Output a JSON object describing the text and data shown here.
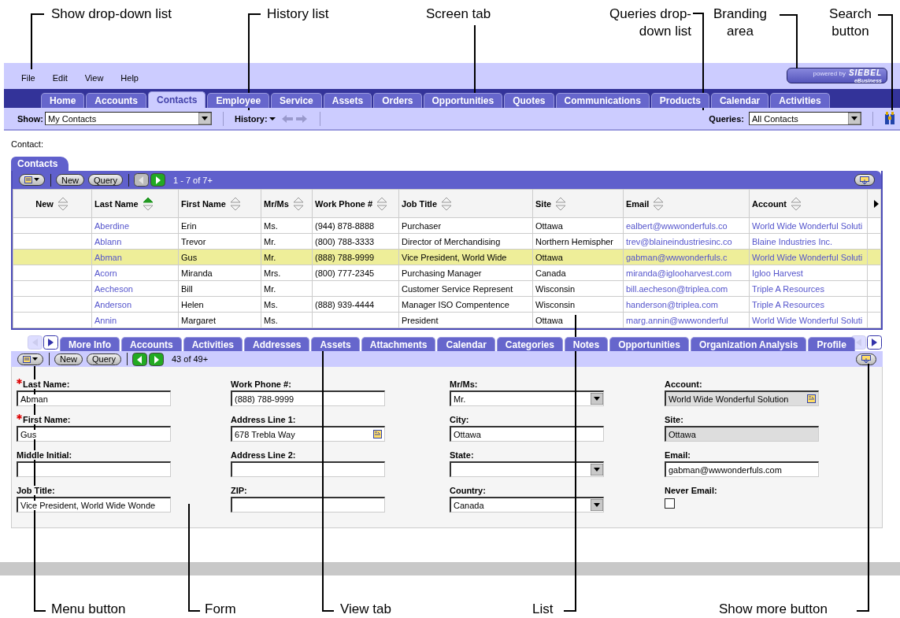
{
  "top_callouts": [
    {
      "lines": [
        "Show drop-down list"
      ]
    },
    {
      "lines": [
        "History list"
      ]
    },
    {
      "lines": [
        "Screen tab"
      ]
    },
    {
      "lines": [
        "Queries drop-",
        "down list"
      ]
    },
    {
      "lines": [
        "Branding",
        "area"
      ]
    },
    {
      "lines": [
        "Search",
        "button"
      ]
    }
  ],
  "menu_bar": [
    "File",
    "Edit",
    "View",
    "Help"
  ],
  "branding": {
    "prefix": "powered by",
    "brand": "SIEBEL",
    "suffix": "eBusiness"
  },
  "screen_tabs": [
    {
      "label": "Home",
      "selected": false
    },
    {
      "label": "Accounts",
      "selected": false
    },
    {
      "label": "Contacts",
      "selected": true
    },
    {
      "label": "Employee",
      "selected": false
    },
    {
      "label": "Service",
      "selected": false
    },
    {
      "label": "Assets",
      "selected": false
    },
    {
      "label": "Orders",
      "selected": false
    },
    {
      "label": "Opportunities",
      "selected": false
    },
    {
      "label": "Quotes",
      "selected": false
    },
    {
      "label": "Communications",
      "selected": false
    },
    {
      "label": "Products",
      "selected": false
    },
    {
      "label": "Calendar",
      "selected": false
    },
    {
      "label": "Activities",
      "selected": false
    }
  ],
  "show": {
    "label": "Show:",
    "value": "My Contacts"
  },
  "history": {
    "label": "History:"
  },
  "queries": {
    "label": "Queries:",
    "value": "All Contacts"
  },
  "context_label": "Contact:",
  "list_applet": {
    "title": "Contacts",
    "buttons": [
      "New",
      "Query"
    ],
    "nav": [
      {
        "kind": "prev",
        "disabled": true
      },
      {
        "kind": "next",
        "disabled": false
      }
    ],
    "record_count": "1 - 7 of 7+",
    "columns": [
      {
        "label": "New",
        "sorted": false
      },
      {
        "label": "Last Name",
        "sorted": true
      },
      {
        "label": "First Name",
        "sorted": false
      },
      {
        "label": "Mr/Ms",
        "sorted": false
      },
      {
        "label": "Work Phone #",
        "sorted": false
      },
      {
        "label": "Job Title",
        "sorted": false
      },
      {
        "label": "Site",
        "sorted": false
      },
      {
        "label": "Email",
        "sorted": false
      },
      {
        "label": "Account",
        "sorted": false
      }
    ],
    "rows": [
      {
        "selected": false,
        "cells": [
          "",
          "Aberdine",
          "Erin",
          "Ms.",
          "(944) 878-8888",
          "Purchaser",
          "Ottawa",
          "ealbert@wwwonderfuls.co",
          "World Wide Wonderful Soluti"
        ]
      },
      {
        "selected": false,
        "cells": [
          "",
          "Ablann",
          "Trevor",
          "Mr.",
          "(800) 788-3333",
          "Director of Merchandising",
          "Northern Hemispher",
          "trev@blaineindustriesinc.co",
          "Blaine Industries Inc."
        ]
      },
      {
        "selected": true,
        "cells": [
          "",
          "Abman",
          "Gus",
          "Mr.",
          "(888) 788-9999",
          "Vice President, World Wide",
          "Ottawa",
          "gabman@wwwonderfuls.c",
          "World Wide Wonderful Soluti"
        ]
      },
      {
        "selected": false,
        "cells": [
          "",
          "Acorn",
          "Miranda",
          "Mrs.",
          "(800) 777-2345",
          "Purchasing Manager",
          "Canada",
          "miranda@iglooharvest.com",
          "Igloo Harvest"
        ]
      },
      {
        "selected": false,
        "cells": [
          "",
          "Aecheson",
          "Bill",
          "Mr.",
          "",
          "Customer Service Represent",
          "Wisconsin",
          "bill.aecheson@triplea.com",
          "Triple A Resources"
        ]
      },
      {
        "selected": false,
        "cells": [
          "",
          "Anderson",
          "Helen",
          "Ms.",
          "(888) 939-4444",
          "Manager ISO Compentence",
          "Wisconsin",
          "handerson@triplea.com",
          "Triple A Resources"
        ]
      },
      {
        "selected": false,
        "cells": [
          "",
          "Annin",
          "Margaret",
          "Ms.",
          "",
          "President",
          "Ottawa",
          "marg.annin@wwwonderful",
          "World Wide Wonderful Soluti"
        ]
      }
    ]
  },
  "view_tab_scroll": [
    {
      "kind": "left",
      "disabled": true
    },
    {
      "kind": "right",
      "disabled": false
    }
  ],
  "view_tabs": [
    {
      "label": "More Info",
      "selected": false
    },
    {
      "label": "Accounts",
      "selected": false
    },
    {
      "label": "Activities",
      "selected": false
    },
    {
      "label": "Addresses",
      "selected": false
    },
    {
      "label": "Assets",
      "selected": false
    },
    {
      "label": "Attachments",
      "selected": false
    },
    {
      "label": "Calendar",
      "selected": false
    },
    {
      "label": "Categories",
      "selected": false
    },
    {
      "label": "Notes",
      "selected": false
    },
    {
      "label": "Opportunities",
      "selected": false
    },
    {
      "label": "Organization Analysis",
      "selected": false
    },
    {
      "label": "Profile",
      "selected": false
    }
  ],
  "form_applet": {
    "buttons": [
      "New",
      "Query"
    ],
    "nav": [
      {
        "kind": "prev",
        "disabled": false
      },
      {
        "kind": "next",
        "disabled": false
      }
    ],
    "record_count": "43 of 49+",
    "columns": [
      [
        {
          "label": "Last Name:",
          "required": true,
          "kind": "text",
          "value": "Abman"
        },
        {
          "label": "First Name:",
          "required": true,
          "kind": "text",
          "value": "Gus"
        },
        {
          "label": "Middle Initial:",
          "required": false,
          "kind": "text"
        },
        {
          "label": "Job Title:",
          "required": false,
          "kind": "text",
          "value": "Vice President, World Wide Wonde"
        }
      ],
      [
        {
          "label": "Work Phone #:",
          "required": false,
          "kind": "text",
          "value": "(888) 788-9999"
        },
        {
          "label": "Address Line 1:",
          "required": false,
          "kind": "picker",
          "value": "678 Trebla Way"
        },
        {
          "label": "Address Line 2:",
          "required": false,
          "kind": "text"
        },
        {
          "label": "ZIP:",
          "required": false,
          "kind": "text"
        }
      ],
      [
        {
          "label": "Mr/Ms:",
          "required": false,
          "kind": "select",
          "value": "Mr."
        },
        {
          "label": "City:",
          "required": false,
          "kind": "text",
          "value": "Ottawa"
        },
        {
          "label": "State:",
          "required": false,
          "kind": "select"
        },
        {
          "label": "Country:",
          "required": false,
          "kind": "select",
          "value": "Canada"
        }
      ],
      [
        {
          "label": "Account:",
          "required": false,
          "kind": "locked_picker",
          "value": "World Wide Wonderful Solution"
        },
        {
          "label": "Site:",
          "required": false,
          "kind": "locked_text",
          "value": "Ottawa"
        },
        {
          "label": "Email:",
          "required": false,
          "kind": "text",
          "value": "gabman@wwwonderfuls.com"
        },
        {
          "label": "Never Email:",
          "required": false,
          "kind": "checkbox",
          "checked": false
        }
      ]
    ]
  },
  "bottom_callouts": [
    {
      "lines": [
        "Menu button"
      ]
    },
    {
      "lines": [
        "Form"
      ]
    },
    {
      "lines": [
        "View tab"
      ]
    },
    {
      "lines": [
        "List"
      ]
    },
    {
      "lines": [
        "Show more button"
      ]
    }
  ]
}
